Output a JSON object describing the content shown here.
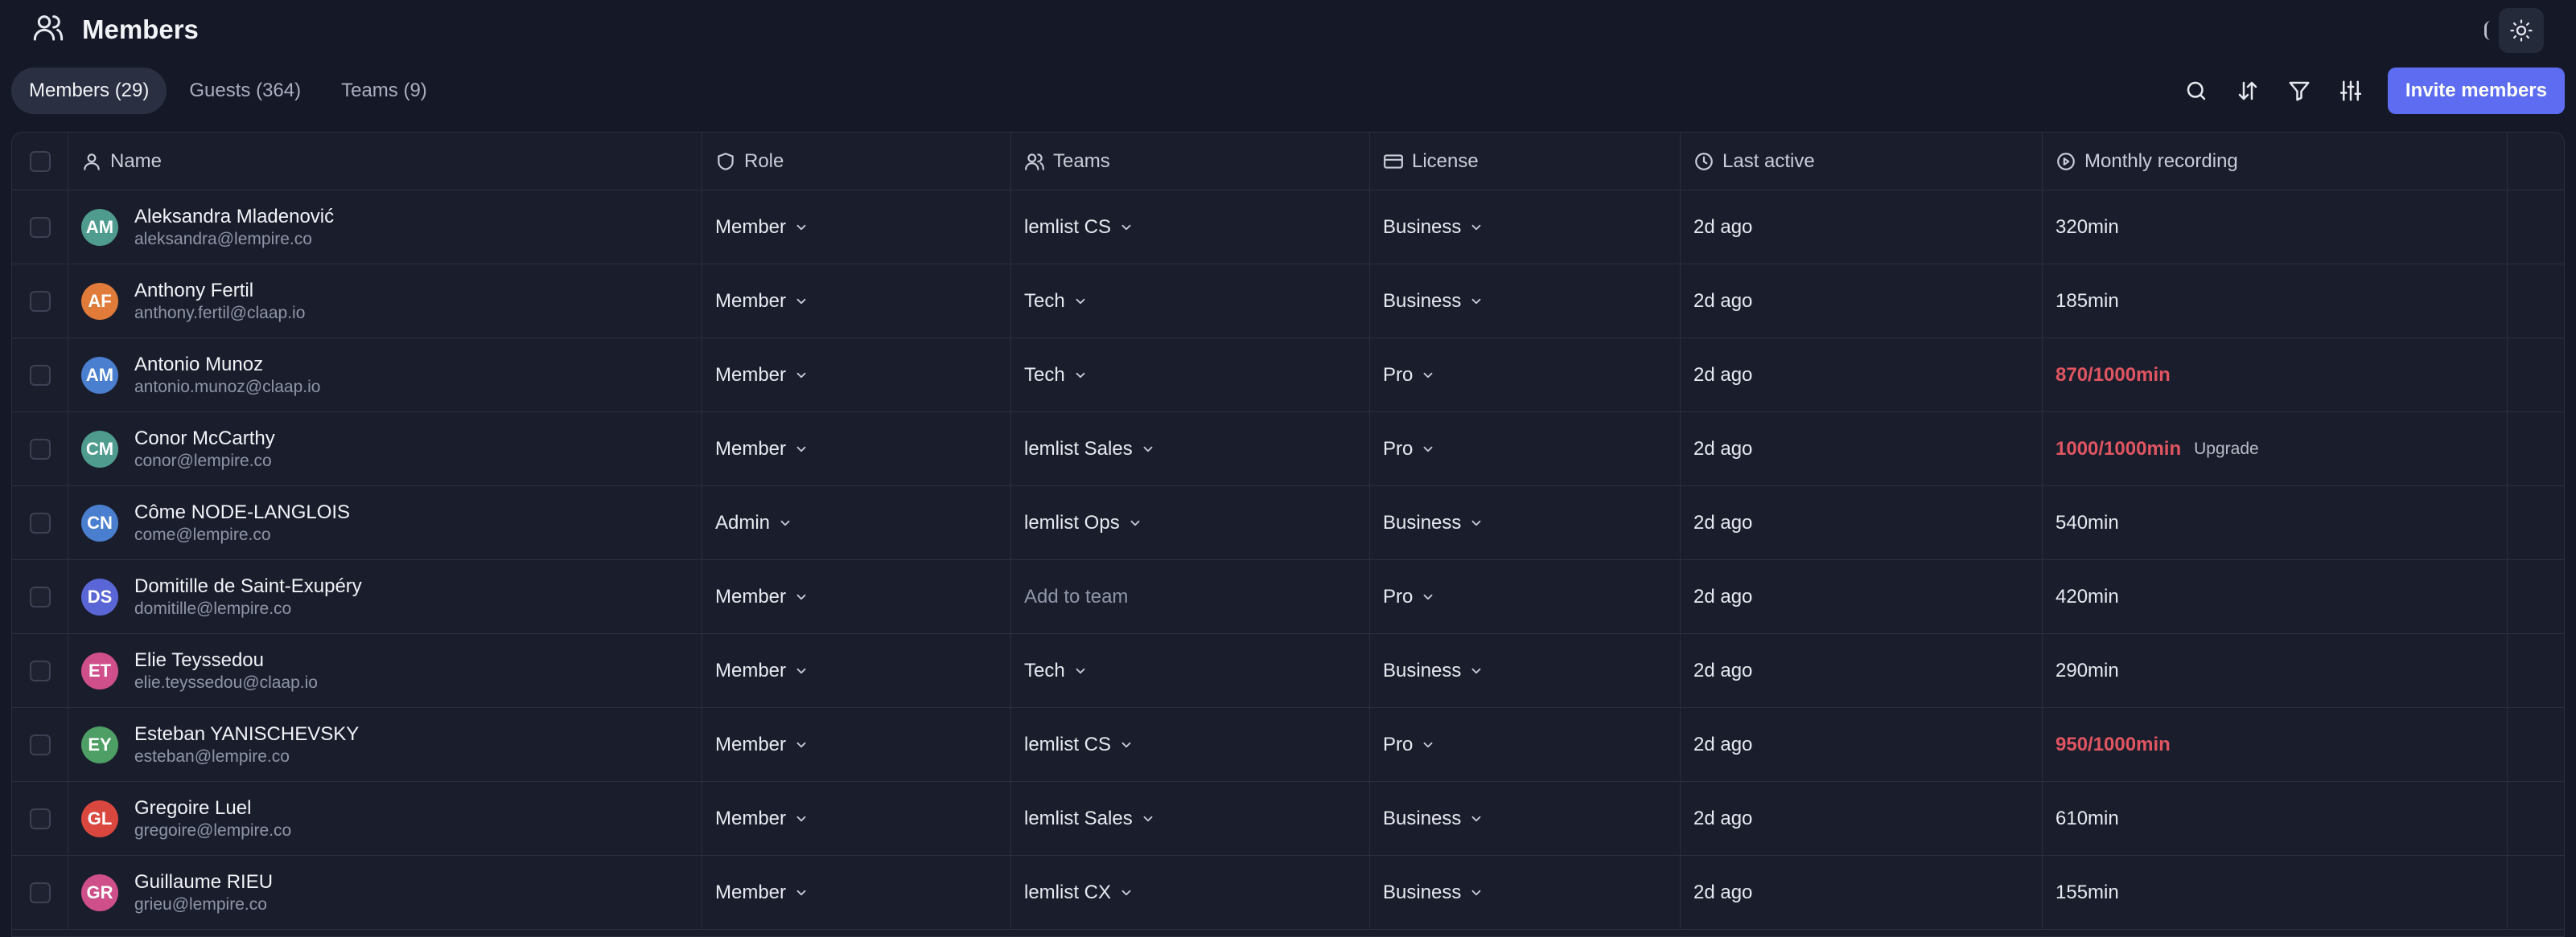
{
  "header": {
    "title": "Members"
  },
  "tabs": [
    {
      "label": "Members (29)",
      "active": true
    },
    {
      "label": "Guests (364)",
      "active": false
    },
    {
      "label": "Teams (9)",
      "active": false
    }
  ],
  "toolbar": {
    "invite_label": "Invite members",
    "icons": [
      "search-icon",
      "sort-icon",
      "filter-icon",
      "settings-sliders-icon"
    ]
  },
  "columns": [
    "Name",
    "Role",
    "Teams",
    "License",
    "Last active",
    "Monthly recording"
  ],
  "colors": {
    "accent": "#5d6cf0",
    "danger": "#e05561",
    "background": "#151826"
  },
  "rows": [
    {
      "initials": "AM",
      "avatar_color": "#4f9c8f",
      "name": "Aleksandra Mladenović",
      "email": "aleksandra@lempire.co",
      "role": "Member",
      "team": "lemlist CS",
      "license": "Business",
      "last_active": "2d ago",
      "recording": "320min",
      "over_quota": false,
      "upgrade": ""
    },
    {
      "initials": "AF",
      "avatar_color": "#e07b39",
      "name": "Anthony Fertil",
      "email": "anthony.fertil@claap.io",
      "role": "Member",
      "team": "Tech",
      "license": "Business",
      "last_active": "2d ago",
      "recording": "185min",
      "over_quota": false,
      "upgrade": ""
    },
    {
      "initials": "AM",
      "avatar_color": "#4a7fd0",
      "name": "Antonio Munoz",
      "email": "antonio.munoz@claap.io",
      "role": "Member",
      "team": "Tech",
      "license": "Pro",
      "last_active": "2d ago",
      "recording": "870/1000min",
      "over_quota": true,
      "upgrade": ""
    },
    {
      "initials": "CM",
      "avatar_color": "#4f9c8f",
      "name": "Conor McCarthy",
      "email": "conor@lempire.co",
      "role": "Member",
      "team": "lemlist Sales",
      "license": "Pro",
      "last_active": "2d ago",
      "recording": "1000/1000min",
      "over_quota": true,
      "upgrade": "Upgrade"
    },
    {
      "initials": "CN",
      "avatar_color": "#4a7fd0",
      "name": "Côme NODE-LANGLOIS",
      "email": "come@lempire.co",
      "role": "Admin",
      "team": "lemlist Ops",
      "license": "Business",
      "last_active": "2d ago",
      "recording": "540min",
      "over_quota": false,
      "upgrade": ""
    },
    {
      "initials": "DS",
      "avatar_color": "#5a66d6",
      "name": "Domitille de Saint-Exupéry",
      "email": "domitille@lempire.co",
      "role": "Member",
      "team": "Add to team",
      "team_empty": true,
      "license": "Pro",
      "last_active": "2d ago",
      "recording": "420min",
      "over_quota": false,
      "upgrade": ""
    },
    {
      "initials": "ET",
      "avatar_color": "#cf4f8a",
      "name": "Elie Teyssedou",
      "email": "elie.teyssedou@claap.io",
      "role": "Member",
      "team": "Tech",
      "license": "Business",
      "last_active": "2d ago",
      "recording": "290min",
      "over_quota": false,
      "upgrade": ""
    },
    {
      "initials": "EY",
      "avatar_color": "#4e9f65",
      "name": "Esteban YANISCHEVSKY",
      "email": "esteban@lempire.co",
      "role": "Member",
      "team": "lemlist CS",
      "license": "Pro",
      "last_active": "2d ago",
      "recording": "950/1000min",
      "over_quota": true,
      "upgrade": ""
    },
    {
      "initials": "GL",
      "avatar_color": "#d9473f",
      "name": "Gregoire Luel",
      "email": "gregoire@lempire.co",
      "role": "Member",
      "team": "lemlist Sales",
      "license": "Business",
      "last_active": "2d ago",
      "recording": "610min",
      "over_quota": false,
      "upgrade": ""
    },
    {
      "initials": "GR",
      "avatar_color": "#cf4f8a",
      "name": "Guillaume RIEU",
      "email": "grieu@lempire.co",
      "role": "Member",
      "team": "lemlist CX",
      "license": "Business",
      "last_active": "2d ago",
      "recording": "155min",
      "over_quota": false,
      "upgrade": ""
    }
  ]
}
